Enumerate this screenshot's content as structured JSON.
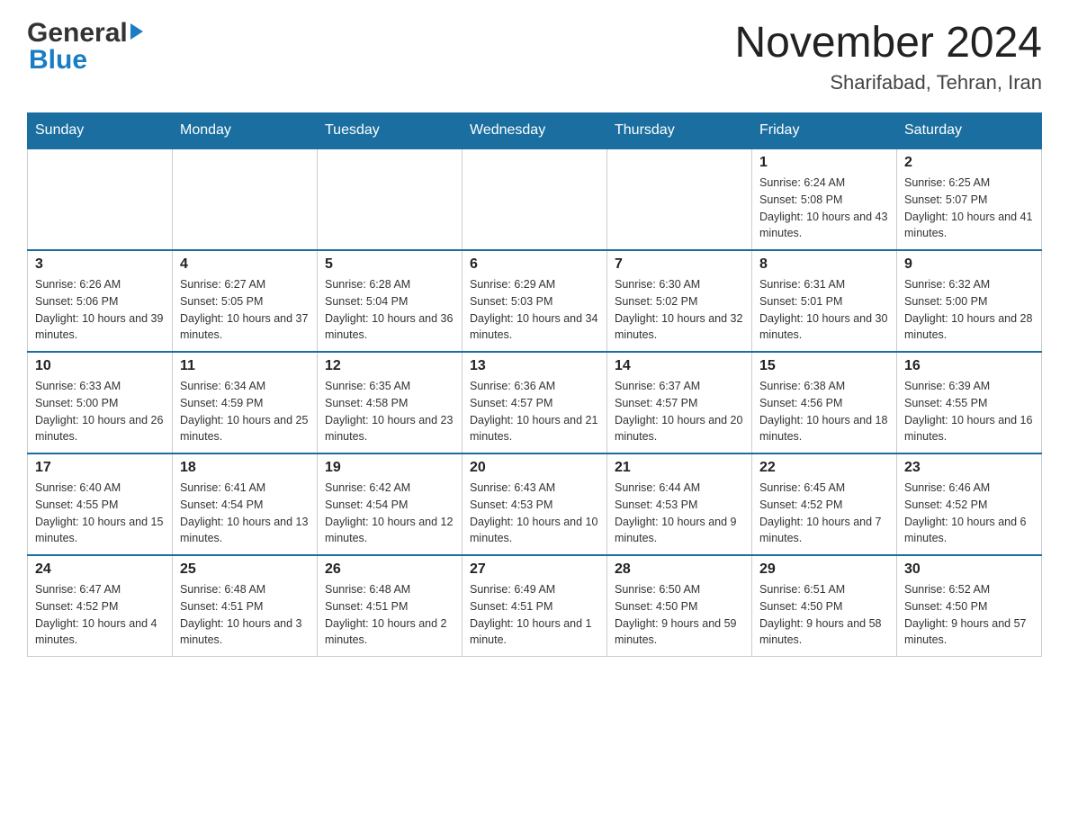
{
  "header": {
    "logo_general": "General",
    "logo_blue": "Blue",
    "month_title": "November 2024",
    "location": "Sharifabad, Tehran, Iran"
  },
  "weekdays": [
    "Sunday",
    "Monday",
    "Tuesday",
    "Wednesday",
    "Thursday",
    "Friday",
    "Saturday"
  ],
  "weeks": [
    [
      {
        "day": "",
        "info": ""
      },
      {
        "day": "",
        "info": ""
      },
      {
        "day": "",
        "info": ""
      },
      {
        "day": "",
        "info": ""
      },
      {
        "day": "",
        "info": ""
      },
      {
        "day": "1",
        "info": "Sunrise: 6:24 AM\nSunset: 5:08 PM\nDaylight: 10 hours and 43 minutes."
      },
      {
        "day": "2",
        "info": "Sunrise: 6:25 AM\nSunset: 5:07 PM\nDaylight: 10 hours and 41 minutes."
      }
    ],
    [
      {
        "day": "3",
        "info": "Sunrise: 6:26 AM\nSunset: 5:06 PM\nDaylight: 10 hours and 39 minutes."
      },
      {
        "day": "4",
        "info": "Sunrise: 6:27 AM\nSunset: 5:05 PM\nDaylight: 10 hours and 37 minutes."
      },
      {
        "day": "5",
        "info": "Sunrise: 6:28 AM\nSunset: 5:04 PM\nDaylight: 10 hours and 36 minutes."
      },
      {
        "day": "6",
        "info": "Sunrise: 6:29 AM\nSunset: 5:03 PM\nDaylight: 10 hours and 34 minutes."
      },
      {
        "day": "7",
        "info": "Sunrise: 6:30 AM\nSunset: 5:02 PM\nDaylight: 10 hours and 32 minutes."
      },
      {
        "day": "8",
        "info": "Sunrise: 6:31 AM\nSunset: 5:01 PM\nDaylight: 10 hours and 30 minutes."
      },
      {
        "day": "9",
        "info": "Sunrise: 6:32 AM\nSunset: 5:00 PM\nDaylight: 10 hours and 28 minutes."
      }
    ],
    [
      {
        "day": "10",
        "info": "Sunrise: 6:33 AM\nSunset: 5:00 PM\nDaylight: 10 hours and 26 minutes."
      },
      {
        "day": "11",
        "info": "Sunrise: 6:34 AM\nSunset: 4:59 PM\nDaylight: 10 hours and 25 minutes."
      },
      {
        "day": "12",
        "info": "Sunrise: 6:35 AM\nSunset: 4:58 PM\nDaylight: 10 hours and 23 minutes."
      },
      {
        "day": "13",
        "info": "Sunrise: 6:36 AM\nSunset: 4:57 PM\nDaylight: 10 hours and 21 minutes."
      },
      {
        "day": "14",
        "info": "Sunrise: 6:37 AM\nSunset: 4:57 PM\nDaylight: 10 hours and 20 minutes."
      },
      {
        "day": "15",
        "info": "Sunrise: 6:38 AM\nSunset: 4:56 PM\nDaylight: 10 hours and 18 minutes."
      },
      {
        "day": "16",
        "info": "Sunrise: 6:39 AM\nSunset: 4:55 PM\nDaylight: 10 hours and 16 minutes."
      }
    ],
    [
      {
        "day": "17",
        "info": "Sunrise: 6:40 AM\nSunset: 4:55 PM\nDaylight: 10 hours and 15 minutes."
      },
      {
        "day": "18",
        "info": "Sunrise: 6:41 AM\nSunset: 4:54 PM\nDaylight: 10 hours and 13 minutes."
      },
      {
        "day": "19",
        "info": "Sunrise: 6:42 AM\nSunset: 4:54 PM\nDaylight: 10 hours and 12 minutes."
      },
      {
        "day": "20",
        "info": "Sunrise: 6:43 AM\nSunset: 4:53 PM\nDaylight: 10 hours and 10 minutes."
      },
      {
        "day": "21",
        "info": "Sunrise: 6:44 AM\nSunset: 4:53 PM\nDaylight: 10 hours and 9 minutes."
      },
      {
        "day": "22",
        "info": "Sunrise: 6:45 AM\nSunset: 4:52 PM\nDaylight: 10 hours and 7 minutes."
      },
      {
        "day": "23",
        "info": "Sunrise: 6:46 AM\nSunset: 4:52 PM\nDaylight: 10 hours and 6 minutes."
      }
    ],
    [
      {
        "day": "24",
        "info": "Sunrise: 6:47 AM\nSunset: 4:52 PM\nDaylight: 10 hours and 4 minutes."
      },
      {
        "day": "25",
        "info": "Sunrise: 6:48 AM\nSunset: 4:51 PM\nDaylight: 10 hours and 3 minutes."
      },
      {
        "day": "26",
        "info": "Sunrise: 6:48 AM\nSunset: 4:51 PM\nDaylight: 10 hours and 2 minutes."
      },
      {
        "day": "27",
        "info": "Sunrise: 6:49 AM\nSunset: 4:51 PM\nDaylight: 10 hours and 1 minute."
      },
      {
        "day": "28",
        "info": "Sunrise: 6:50 AM\nSunset: 4:50 PM\nDaylight: 9 hours and 59 minutes."
      },
      {
        "day": "29",
        "info": "Sunrise: 6:51 AM\nSunset: 4:50 PM\nDaylight: 9 hours and 58 minutes."
      },
      {
        "day": "30",
        "info": "Sunrise: 6:52 AM\nSunset: 4:50 PM\nDaylight: 9 hours and 57 minutes."
      }
    ]
  ]
}
